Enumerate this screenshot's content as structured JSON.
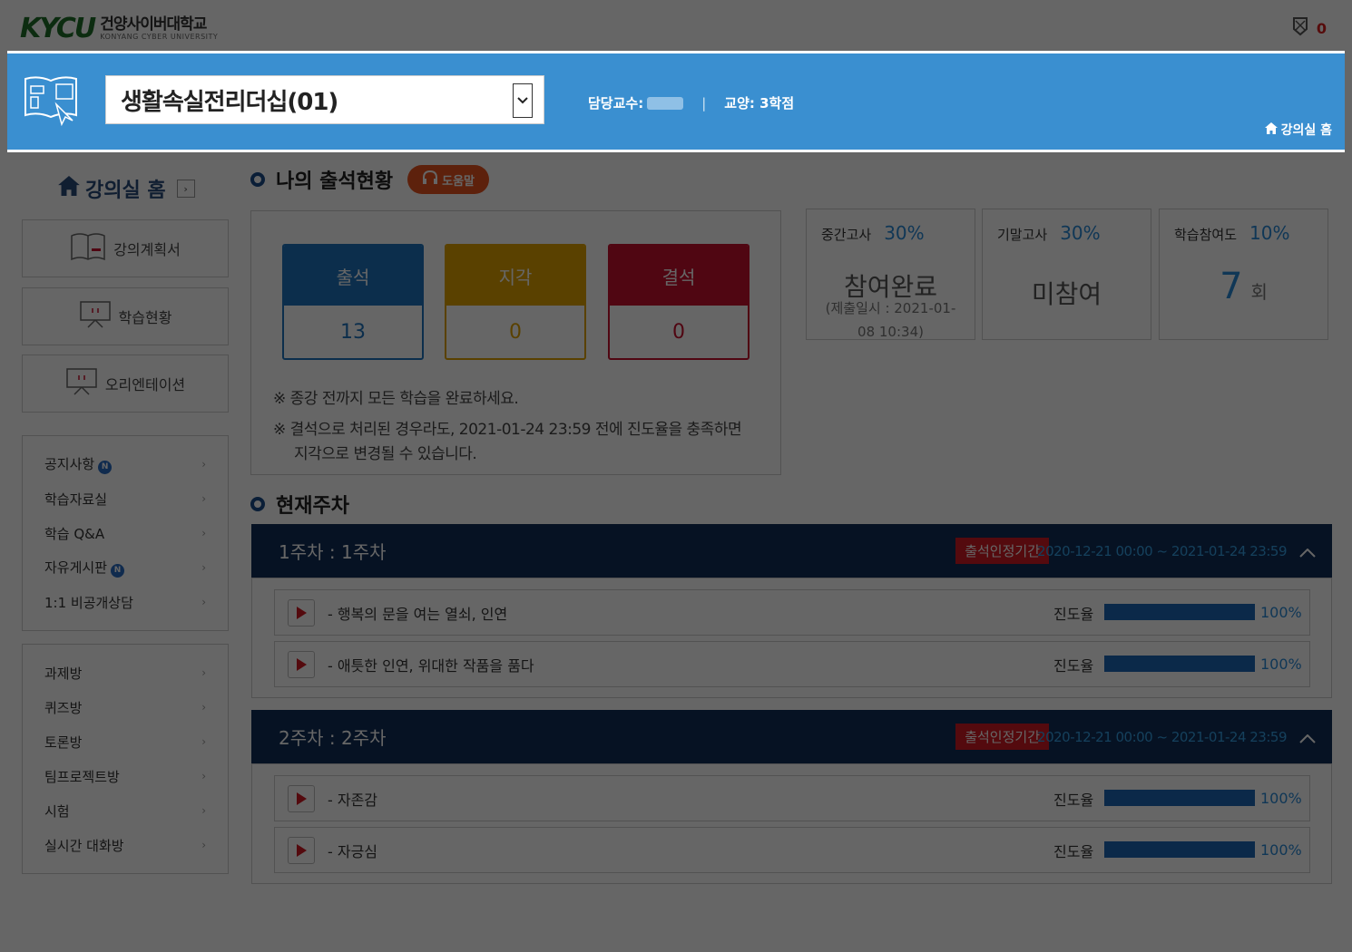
{
  "header": {
    "logo_mark": "KYCU",
    "logo_ko": "건양사이버대학교",
    "logo_en": "KONYANG CYBER UNIVERSITY",
    "notification_count": "0"
  },
  "course": {
    "name": "생활속실전리더십(01)",
    "professor_label": "담당교수:",
    "category": "교양: 3학점",
    "home_link": "강의실 홈"
  },
  "sidebar": {
    "home": "강의실 홈",
    "buttons": [
      "강의계획서",
      "학습현황",
      "오리엔테이션"
    ],
    "list1": [
      {
        "label": "공지사항",
        "new": "N"
      },
      {
        "label": "학습자료실"
      },
      {
        "label": "학습 Q&A"
      },
      {
        "label": "자유게시판",
        "new": "N"
      },
      {
        "label": "1:1 비공개상담"
      }
    ],
    "list2": [
      {
        "label": "과제방"
      },
      {
        "label": "퀴즈방"
      },
      {
        "label": "토론방"
      },
      {
        "label": "팀프로젝트방"
      },
      {
        "label": "시험"
      },
      {
        "label": "실시간 대화방"
      }
    ]
  },
  "attendance": {
    "title": "나의 출석현황",
    "help": "도움말",
    "cards": [
      {
        "label": "출석",
        "value": "13",
        "color": "#1e74bf"
      },
      {
        "label": "지각",
        "value": "0",
        "color": "#e0a400"
      },
      {
        "label": "결석",
        "value": "0",
        "color": "#c8102e"
      }
    ],
    "note1": "※ 종강 전까지 모든 학습을 완료하세요.",
    "note2a": "※ 결석으로 처리된 경우라도, 2021-01-24 23:59 전에 진도율을 충족하면",
    "note2b": "지각으로 변경될 수 있습니다."
  },
  "scores": [
    {
      "label": "중간고사",
      "pct": "30%",
      "main": "참여완료",
      "sub1": "(제출일시 : 2021-01-",
      "sub2": "08 10:34)"
    },
    {
      "label": "기말고사",
      "pct": "30%",
      "main": "미참여"
    },
    {
      "label": "학습참여도",
      "pct": "10%",
      "main": "7",
      "unit": "회"
    }
  ],
  "current_week": {
    "title": "현재주차",
    "weeks": [
      {
        "title": "1주차 : 1주차",
        "badge": "출석인정기간",
        "period": "2020-12-21 00:00 ~ 2021-01-24 23:59",
        "lessons": [
          {
            "title": "- 행복의 문을 여는 열쇠, 인연",
            "progress_label": "진도율",
            "progress": 100,
            "pct": "100%"
          },
          {
            "title": "- 애틋한 인연, 위대한 작품을 품다",
            "progress_label": "진도율",
            "progress": 100,
            "pct": "100%"
          }
        ]
      },
      {
        "title": "2주차 : 2주차",
        "badge": "출석인정기간",
        "period": "2020-12-21 00:00 ~ 2021-01-24 23:59",
        "lessons": [
          {
            "title": "- 자존감",
            "progress_label": "진도율",
            "progress": 100,
            "pct": "100%"
          },
          {
            "title": "- 자긍심",
            "progress_label": "진도율",
            "progress": 100,
            "pct": "100%"
          }
        ]
      }
    ]
  }
}
